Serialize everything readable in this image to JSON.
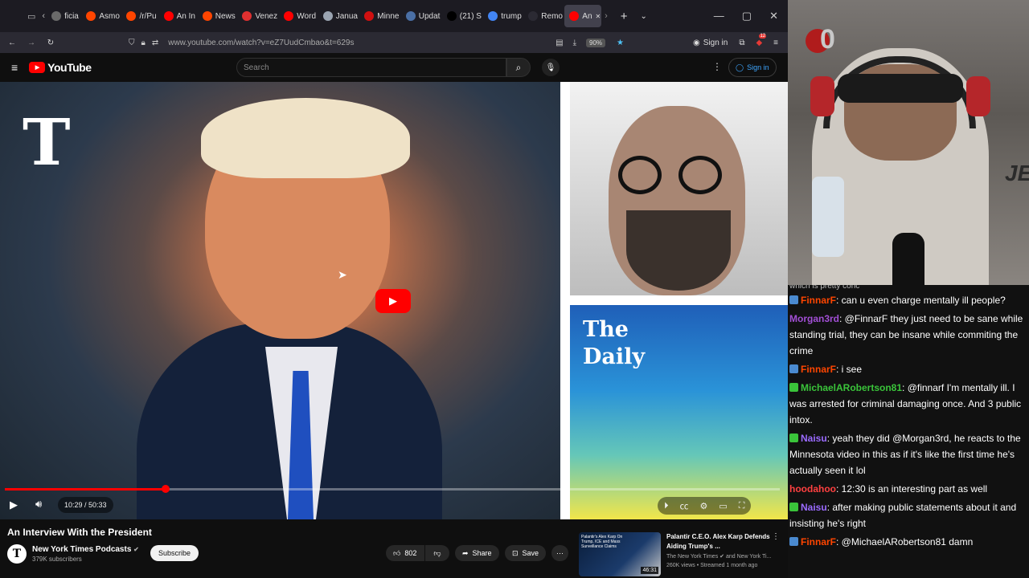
{
  "browser": {
    "tabs": [
      {
        "label": "ficia",
        "color": "#6a6a6a"
      },
      {
        "label": "Asmo",
        "color": "#ff4500"
      },
      {
        "label": "/r/Pu",
        "color": "#ff4500"
      },
      {
        "label": "An In",
        "color": "#ff0000"
      },
      {
        "label": "News",
        "color": "#ff4500"
      },
      {
        "label": "Venez",
        "color": "#e03030"
      },
      {
        "label": "Word",
        "color": "#ff0000"
      },
      {
        "label": "Janua",
        "color": "#9aa4b1"
      },
      {
        "label": "Minne",
        "color": "#d01010"
      },
      {
        "label": "Updat",
        "color": "#4a6fa5"
      },
      {
        "label": "(21) S",
        "color": "#000000"
      },
      {
        "label": "trump",
        "color": "#4285f4"
      },
      {
        "label": "Remo",
        "color": "#2b2a33"
      },
      {
        "label": "An",
        "color": "#ff0000"
      }
    ],
    "new_tab": "+",
    "url": "www.youtube.com/watch?v=eZ7UudCmbao&t=629s",
    "zoom": "90%",
    "sign_in": "Sign in",
    "ext_badge": "12"
  },
  "youtube": {
    "logo_text": "YouTube",
    "search_placeholder": "Search",
    "sign_in": "Sign in"
  },
  "video": {
    "thumb_logo": "T",
    "daily_title_line1": "The",
    "daily_title_line2": "Daily",
    "current_time": "10:29",
    "duration": "50:33",
    "time_display": "10:29 / 50:33",
    "progress_fraction": 0.207,
    "title": "An Interview With the President"
  },
  "channel": {
    "name": "New York Times Podcasts",
    "subscribers": "379K subscribers",
    "subscribe_label": "Subscribe"
  },
  "actions": {
    "likes": "802",
    "share": "Share",
    "save": "Save"
  },
  "recommended": {
    "title": "Palantir C.E.O. Alex Karp Defends Aiding Trump's ...",
    "channel": "The New York Times",
    "channel_suffix": "and New York Ti...",
    "stats": "260K views • Streamed 1 month ago",
    "duration": "46:31",
    "thumb_text": "Palantir's Alex Karp On Trump, ICE and Mass Surveillance Claims"
  },
  "stream": {
    "counter": "0",
    "overlay_logo": "JE"
  },
  "chat": {
    "cut_line": "which is pretty conc",
    "messages": [
      {
        "user": "FinnarF",
        "color": "#ff4500",
        "text": ": can u even charge mentally ill people?",
        "icon": "#4a8ad0"
      },
      {
        "user": "Morgan3rd",
        "color": "#a24fd6",
        "text": ": @FinnarF they just need to be sane while standing trial, they can be insane while commiting the crime",
        "icon": ""
      },
      {
        "user": "FinnarF",
        "color": "#ff4500",
        "text": ": i see",
        "icon": "#4a8ad0"
      },
      {
        "user": "MichaelARobertson81",
        "color": "#3ac43a",
        "text": ": @finnarf I'm mentally ill. I was arrested for criminal damaging once. And 3 public intox.",
        "icon": "#3ac43a"
      },
      {
        "user": "Naisu",
        "color": "#9b6bff",
        "text": ": yeah they did @Morgan3rd, he reacts to the Minnesota video in this as if it's like the first time he's actually seen it lol",
        "icon": "#3ac43a"
      },
      {
        "user": "hoodahoo",
        "color": "#ff4040",
        "text": ": 12:30 is an interesting part as well",
        "icon": ""
      },
      {
        "user": "Naisu",
        "color": "#9b6bff",
        "text": ": after making public statements about it and insisting he's right",
        "icon": "#3ac43a"
      },
      {
        "user": "FinnarF",
        "color": "#ff4500",
        "text": ": @MichaelARobertson81 damn",
        "icon": "#4a8ad0"
      }
    ]
  }
}
